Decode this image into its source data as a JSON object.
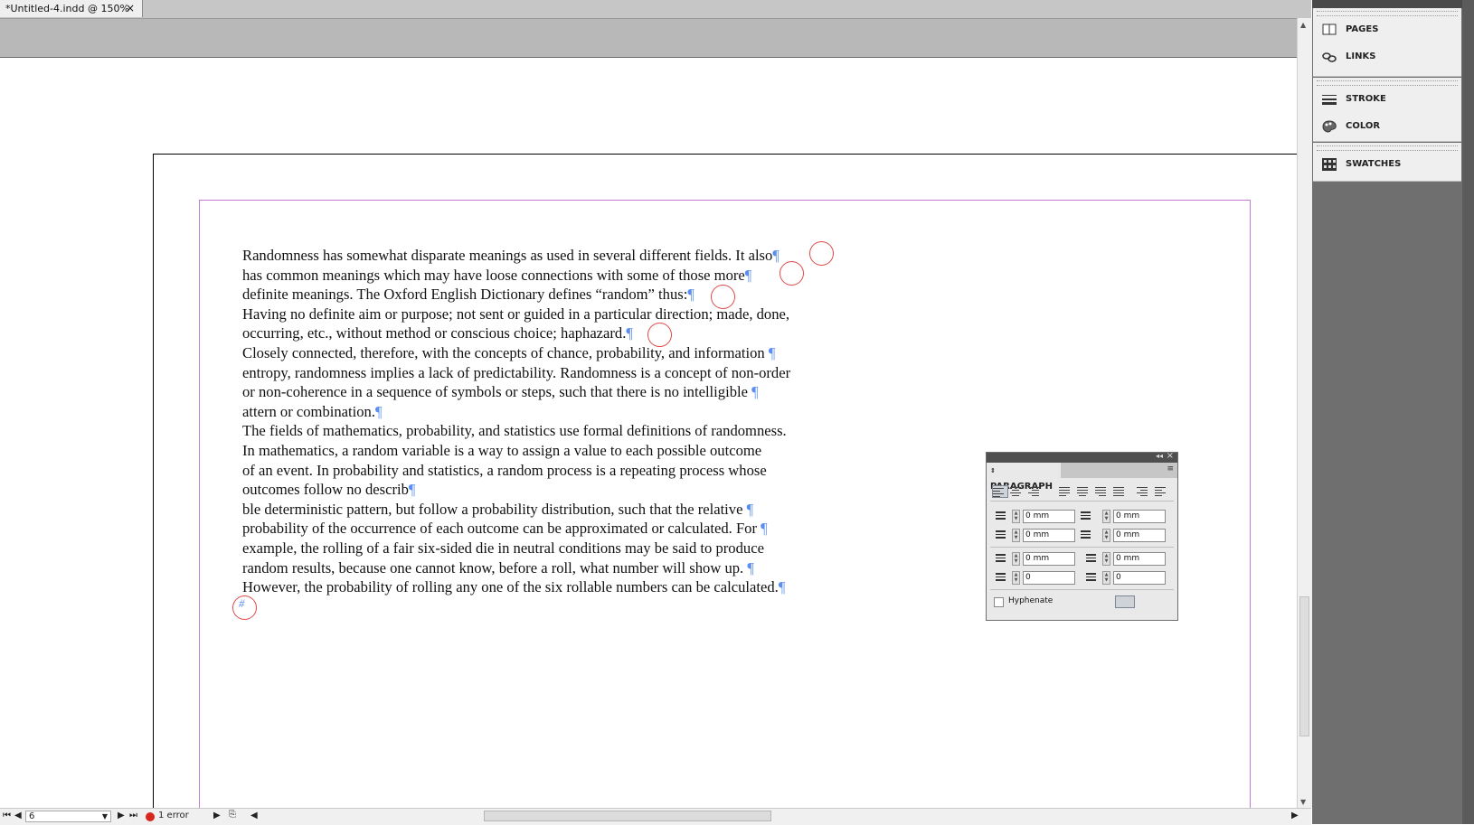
{
  "tab": {
    "title": "*Untitled-4.indd @ 150%",
    "close": "×"
  },
  "panels": [
    {
      "group": "pages-links",
      "items": [
        {
          "label": "PAGES",
          "icon": "pages-icon"
        },
        {
          "label": "LINKS",
          "icon": "links-icon"
        }
      ]
    },
    {
      "group": "stroke-color",
      "items": [
        {
          "label": "STROKE",
          "icon": "stroke-icon"
        },
        {
          "label": "COLOR",
          "icon": "color-icon"
        }
      ]
    },
    {
      "group": "swatches",
      "items": [
        {
          "label": "SWATCHES",
          "icon": "swatches-icon"
        }
      ]
    }
  ],
  "story": {
    "lines": [
      {
        "text": "Randomness has somewhat disparate meanings as used in several different fields. It also",
        "pil": "¶"
      },
      {
        "text": "has common meanings which may have loose connections with some of those more",
        "pil": "¶"
      },
      {
        "text": "definite meanings. The Oxford English Dictionary defines “random” thus:",
        "pil": "¶"
      },
      {
        "text": "Having no definite aim or purpose; not sent or guided in a particular direction; made, done,",
        "pil": ""
      },
      {
        "text": "occurring, etc., without method or conscious choice; haphazard.",
        "pil": "¶"
      },
      {
        "text": "Closely connected, therefore, with the concepts of chance, probability, and information ",
        "pil": "¶"
      },
      {
        "text": "entropy, randomness implies a lack of predictability. Randomness is a concept of non-order",
        "pil": ""
      },
      {
        "text": "or non-coherence in a sequence of symbols or steps, such that there is no intelligible ",
        "pil": "¶"
      },
      {
        "text": "attern or combination.",
        "pil": "¶"
      },
      {
        "text": "The fields of mathematics, probability, and statistics use formal definitions of randomness.",
        "pil": ""
      },
      {
        "text": "In mathematics, a random variable is a way to assign a value to each possible outcome",
        "pil": ""
      },
      {
        "text": "of an event. In probability and statistics, a random process is a repeating process whose",
        "pil": ""
      },
      {
        "text": "outcomes follow no describ",
        "pil": "¶"
      },
      {
        "text": "ble deterministic pattern, but follow a probability distribution, such that the relative ",
        "pil": "¶"
      },
      {
        "text": "probability of the occurrence of each outcome can be approximated or calculated. For ",
        "pil": "¶"
      },
      {
        "text": "example, the rolling of a fair six-sided die in neutral conditions may be said to produce",
        "pil": ""
      },
      {
        "text": "random results, because one cannot know, before a roll, what number will show up. ",
        "pil": "¶"
      },
      {
        "text": "However, the probability of rolling any one of the six rollable numbers can be calculated.",
        "pil": "¶"
      }
    ],
    "end_marker": "#"
  },
  "paragraph_panel": {
    "title": "PARAGRAPH",
    "left_indent": "0 mm",
    "right_indent": "0 mm",
    "first_line_indent": "0 mm",
    "last_line_indent": "0 mm",
    "space_before": "0 mm",
    "space_after": "0 mm",
    "drop_cap_lines": "0",
    "drop_cap_chars": "0",
    "hyphenate_label": "Hyphenate",
    "hyphenate_checked": false
  },
  "status": {
    "page": "6",
    "preflight": "1 error",
    "preflight_color": "#d8251e"
  },
  "colors": {
    "margin_guide": "#c37bd6",
    "hidden_chars": "#5a8ef0",
    "annotation_circles": "#e04848"
  }
}
